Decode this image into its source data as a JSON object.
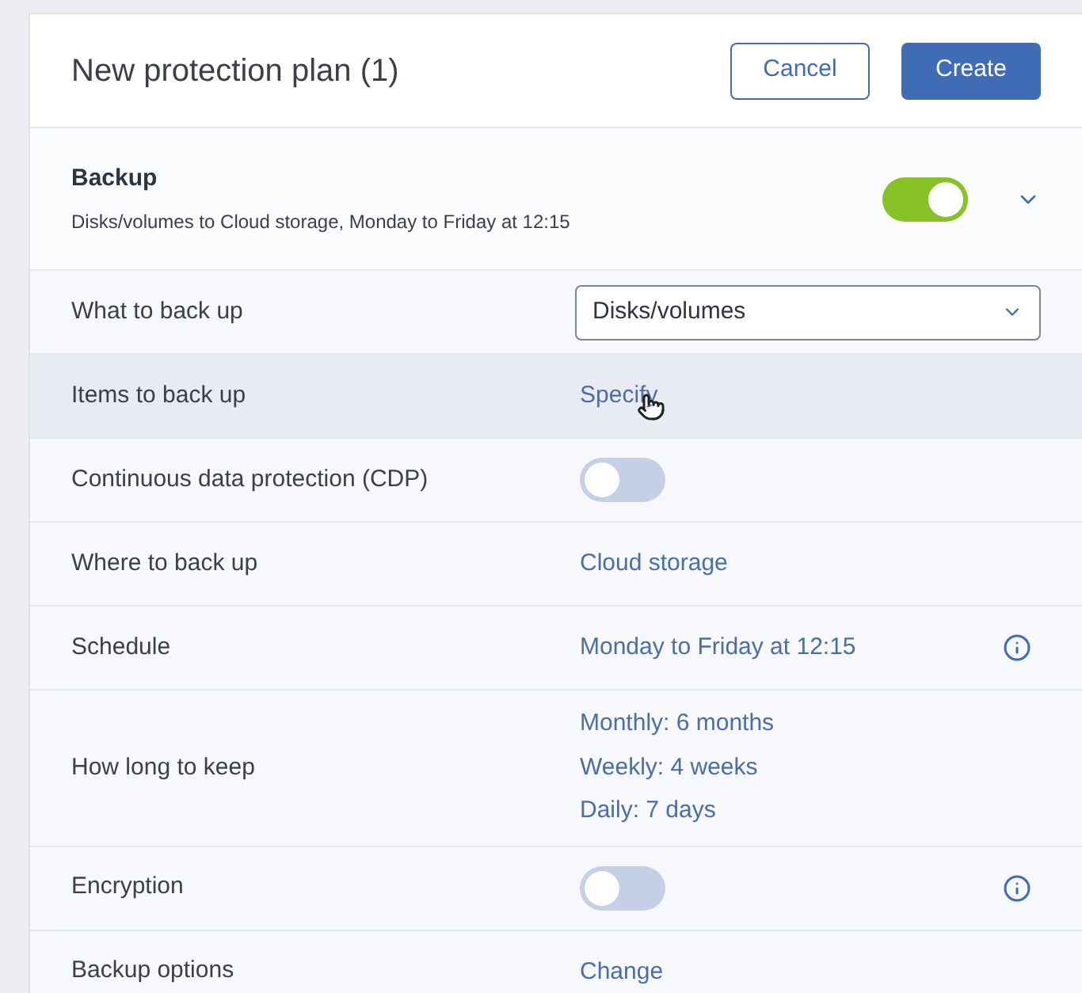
{
  "header": {
    "title": "New protection plan (1)",
    "buttons": [
      {
        "label": "Cancel",
        "kind": "secondary"
      },
      {
        "label": "Create",
        "kind": "primary"
      }
    ]
  },
  "section": {
    "title": "Backup",
    "summary": "Disks/volumes to Cloud storage, Monday to Friday at 12:15",
    "on": true,
    "expanded": true
  },
  "rows": [
    {
      "label": "What to back up",
      "kind": "select",
      "value": "Disks/volumes",
      "highlighted": false
    },
    {
      "label": "Items to back up",
      "kind": "link",
      "value": "Specify",
      "highlighted": true,
      "cursor": true
    },
    {
      "label": "Continuous data protection (CDP)",
      "kind": "toggle",
      "on": false,
      "highlighted": false
    },
    {
      "label": "Where to back up",
      "kind": "link",
      "value": "Cloud storage",
      "highlighted": false
    },
    {
      "label": "Schedule",
      "kind": "link",
      "value": "Monday to Friday at 12:15",
      "info": true,
      "highlighted": false
    },
    {
      "label": "How long to keep",
      "kind": "list",
      "values": [
        "Monthly: 6 months",
        "Weekly: 4 weeks",
        "Daily: 7 days"
      ],
      "highlighted": false
    },
    {
      "label": "Encryption",
      "kind": "toggle",
      "on": false,
      "info": true,
      "highlighted": false
    },
    {
      "label": "Backup options",
      "kind": "link",
      "value": "Change",
      "highlighted": false
    }
  ]
}
